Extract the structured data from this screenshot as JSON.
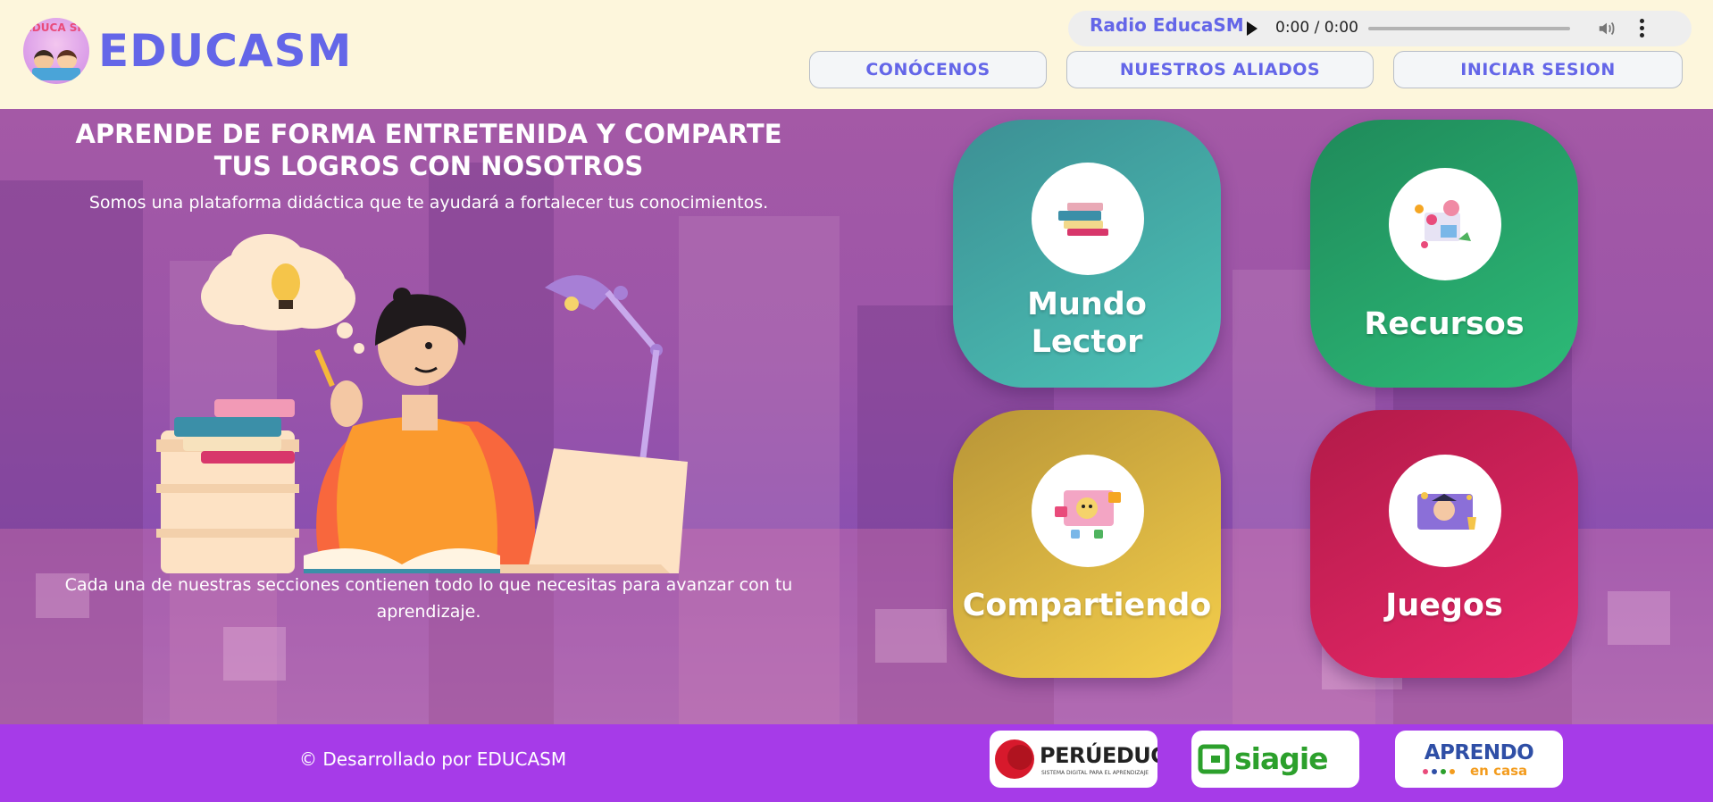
{
  "header": {
    "logo_text": "EDUCA SM",
    "brand": "EDUCASM",
    "radio": {
      "label": "Radio EducaSM",
      "time": "0:00 / 0:00",
      "progress": 0
    },
    "nav": [
      {
        "label": "CONÓCENOS"
      },
      {
        "label": "NUESTROS ALIADOS"
      },
      {
        "label": "INICIAR SESION"
      }
    ]
  },
  "hero": {
    "title": "APRENDE DE FORMA ENTRETENIDA Y COMPARTE TUS LOGROS CON NOSOTROS",
    "subtitle": "Somos una plataforma didáctica que te ayudará a fortalecer tus conocimientos.",
    "footer_text": "Cada una de nuestras secciones contienen todo lo que necesitas para avanzar con tu aprendizaje."
  },
  "cards": [
    {
      "label": "Mundo Lector",
      "icon": "books-icon",
      "color_from": "#3c8f94",
      "color_to": "#4cc3b6"
    },
    {
      "label": "Recursos",
      "icon": "resources-icon",
      "color_from": "#1f8a5a",
      "color_to": "#2dbb78"
    },
    {
      "label": "Compartiendo",
      "icon": "sharing-icon",
      "color_from": "#b89537",
      "color_to": "#f5cf4c"
    },
    {
      "label": "Juegos",
      "icon": "games-icon",
      "color_from": "#b21a48",
      "color_to": "#e8286a"
    }
  ],
  "footer": {
    "copyright": "© Desarrollado por EDUCASM",
    "partners": [
      {
        "name": "PERÚEDUCA",
        "tagline": "SISTEMA DIGITAL PARA EL APRENDIZAJE"
      },
      {
        "name": "siagie"
      },
      {
        "name": "APRENDO",
        "sub": "en casa"
      }
    ]
  },
  "colors": {
    "brand": "#6466e8",
    "footer": "#a63be8",
    "header_bg": "#fdf6dc"
  }
}
